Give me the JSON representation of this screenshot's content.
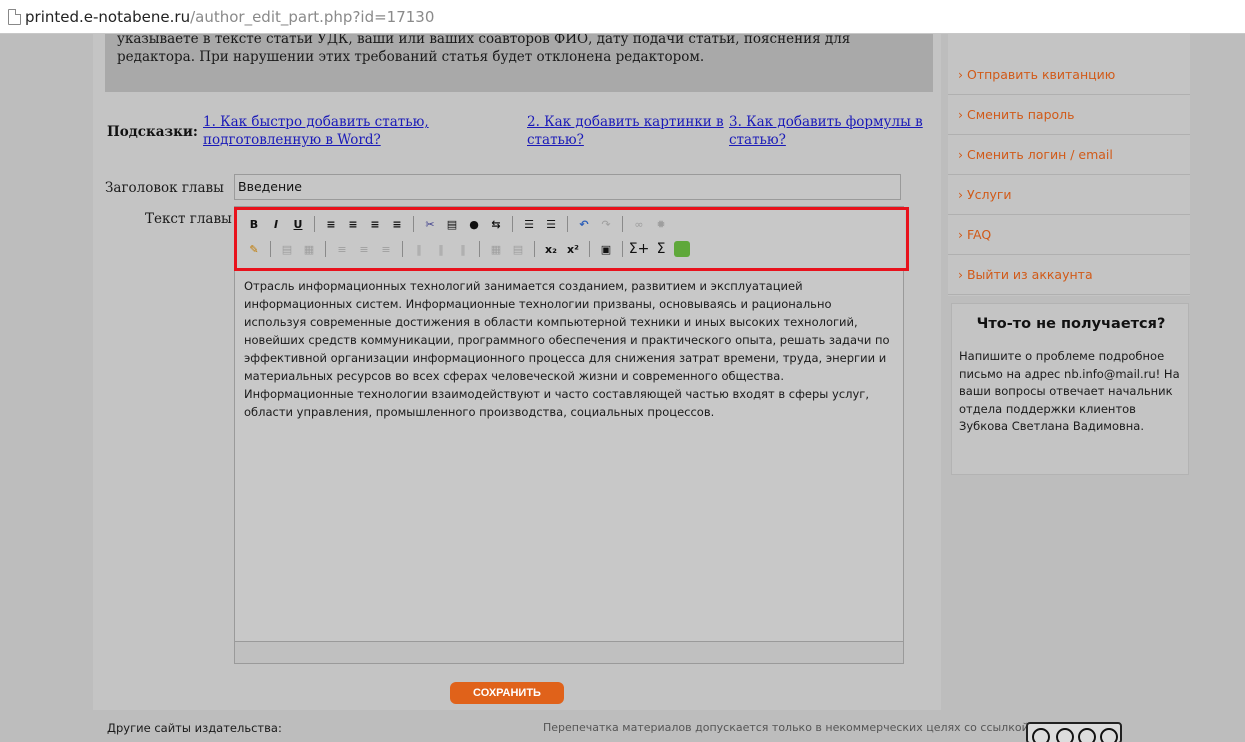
{
  "browser": {
    "url_host": "printed.e-notabene.ru",
    "url_path": "/author_edit_part.php?id=17130"
  },
  "notice": {
    "line1": "указываете в тексте статьи УДК, ваши или ваших соавторов ФИО, дату подачи статьи, пояснения для",
    "line2": "редактора. При нарушении этих требований статья будет отклонена редактором."
  },
  "hints": {
    "label": "Подсказки:",
    "hint1": "1. Как быстро добавить статью, подготовленную в Word?",
    "hint2": "2. Как добавить картинки в статью?",
    "hint3": "3. Как добавить формулы в статью?"
  },
  "form": {
    "title_label": "Заголовок главы",
    "title_value": "Введение",
    "text_label": "Текст главы",
    "text_value": "Отрасль информационных технологий занимается созданием, развитием и эксплуатацией информационных систем. Информационные технологии призваны, основываясь и рационально используя современные достижения в области компьютерной техники и иных высоких технологий, новейших средств коммуникации, программного обеспечения и практического опыта, решать задачи по эффективной организации информационного процесса для снижения затрат времени, труда, энергии и материальных ресурсов во всех сферах человеческой жизни и современного общества. Информационные технологии взаимодействуют и часто составляющей частью входят в сферы услуг, области управления, промышленного производства, социальных процессов.",
    "save_label": "СОХРАНИТЬ"
  },
  "toolbar": {
    "bold": "B",
    "italic": "I",
    "underline": "U",
    "subscript": "x₂",
    "superscript": "x²",
    "sigma1": "Σ+",
    "sigma2": "Σ"
  },
  "sidebar": {
    "items": [
      "Отправить квитанцию",
      "Сменить пароль",
      "Сменить логин / email",
      "Услуги",
      "FAQ",
      "Выйти из аккаунта"
    ]
  },
  "help": {
    "title": "Что-то не получается?",
    "text": "Напишите о проблеме подробное письмо на адрес nb.info@mail.ru! На ваши вопросы отвечает начальник отдела поддержки клиентов Зубкова Светлана Вадимовна."
  },
  "footer": {
    "other_sites": "Другие сайты издательства:",
    "copyright": "Перепечатка материалов допускается только в некоммерческих целях со ссылкой"
  },
  "colors": {
    "accent": "#d15a18",
    "save_button": "#e0621a",
    "highlight": "#e8121c",
    "link": "#1a1ab8"
  }
}
